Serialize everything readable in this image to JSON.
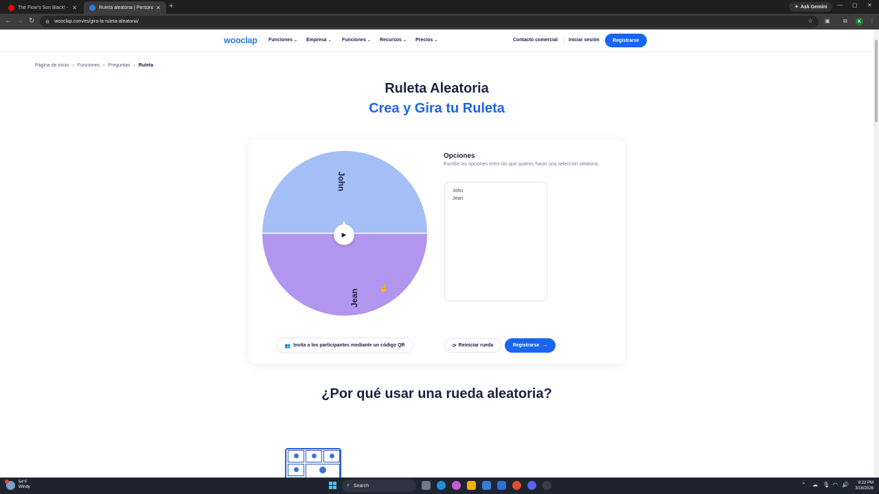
{
  "browser": {
    "tabs": [
      {
        "title": "The Flow's Son Black! - YouTub",
        "favicon_color": "#ff0000",
        "active": false
      },
      {
        "title": "Ruleta aleatoria | Personaliza y",
        "favicon_color": "#2a7be0",
        "active": true
      }
    ],
    "new_tab": "+",
    "gemini_label": "Ask Gemini",
    "url": "wooclap.com/es/gira-la-ruleta-aleatoria/",
    "profile_initial": "K"
  },
  "site": {
    "logo": "wooclap",
    "nav": [
      {
        "label": "Funciones"
      },
      {
        "label": "Empresa"
      },
      {
        "label": "Funciones"
      },
      {
        "label": "Recursos"
      },
      {
        "label": "Precios"
      }
    ],
    "contact": "Contacto comercial",
    "login": "Iniciar sesión",
    "register": "Registrarse"
  },
  "breadcrumb": [
    "Página de inicio",
    "Funciones",
    "Preguntas",
    "Ruleta"
  ],
  "hero": {
    "title": "Ruleta Aleatoria",
    "subtitle": "Crea y Gira tu Ruleta"
  },
  "wheel": {
    "segments": [
      {
        "label": "John",
        "color": "#a3bff5"
      },
      {
        "label": "Jean",
        "color": "#b195ee"
      }
    ]
  },
  "options": {
    "title": "Opciones",
    "description": "Escribe las opciones entre las que quieres hacer una selección aleatoria.",
    "value": "John\nJean"
  },
  "actions": {
    "qr_invite": "Invita a los participantes mediante un código QR",
    "reset": "Reiniciar rueda",
    "register": "Registrarse"
  },
  "section2": {
    "title": "¿Por qué usar una rueda aleatoria?"
  },
  "taskbar": {
    "weather_temp": "54°F",
    "weather_desc": "Windy",
    "search_label": "Search",
    "time": "9:22 PM",
    "date": "3/18/2026"
  },
  "colors": {
    "brand_blue": "#1a65f0",
    "navy_text": "#1b2140"
  }
}
